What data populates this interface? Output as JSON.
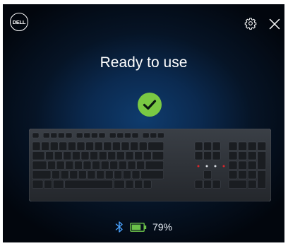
{
  "header": {
    "logo_text": "DELL",
    "settings_icon": "gear-icon",
    "close_icon": "close-icon"
  },
  "main": {
    "status_title": "Ready to use",
    "status_icon": "check-circle-icon",
    "device_image": "keyboard",
    "device_image_text": "Dell keyboard product image"
  },
  "status_bar": {
    "connection_icon": "bluetooth-icon",
    "battery_icon": "battery-icon",
    "battery_level": 0.79,
    "battery_percent": "79%"
  },
  "colors": {
    "accent_green": "#7ac943",
    "battery_green": "#6cc24a",
    "bluetooth_blue": "#4aa3ff",
    "background_center": "#0f3c6e",
    "background_edge": "#02060d",
    "keyboard_body": "#2b2f35",
    "key": "#1a1d21",
    "indicator_red": "#d9262b"
  }
}
